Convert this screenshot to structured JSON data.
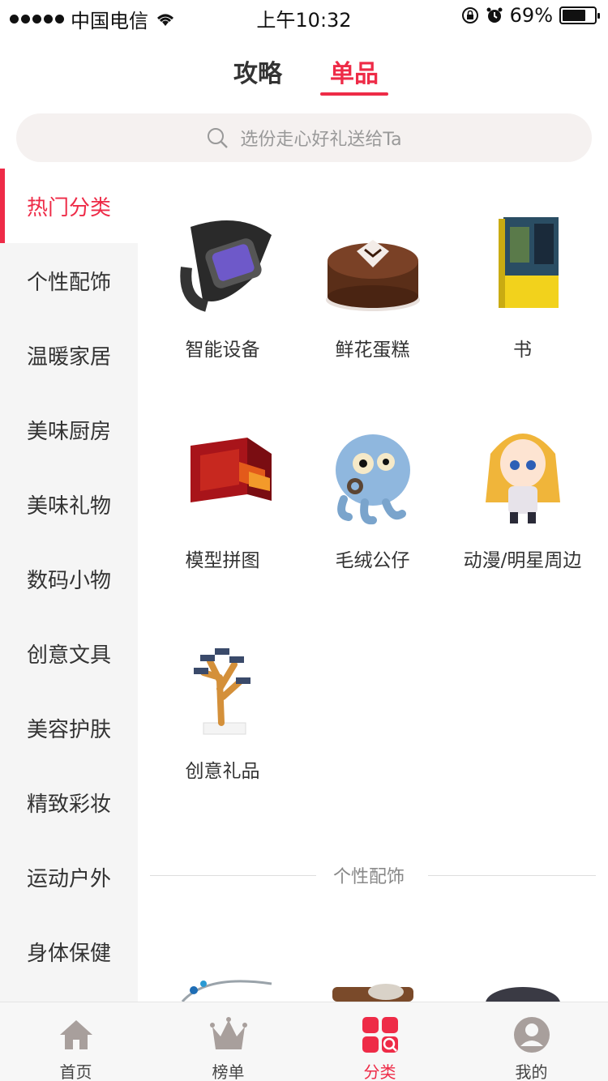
{
  "statusbar": {
    "carrier": "中国电信",
    "time": "上午10:32",
    "battery": "69%"
  },
  "top_tabs": [
    {
      "label": "攻略",
      "active": false
    },
    {
      "label": "单品",
      "active": true
    }
  ],
  "search": {
    "placeholder": "选份走心好礼送给Ta"
  },
  "sidebar": {
    "items": [
      {
        "label": "热门分类",
        "active": true
      },
      {
        "label": "个性配饰"
      },
      {
        "label": "温暖家居"
      },
      {
        "label": "美味厨房"
      },
      {
        "label": "美味礼物"
      },
      {
        "label": "数码小物"
      },
      {
        "label": "创意文具"
      },
      {
        "label": "美容护肤"
      },
      {
        "label": "精致彩妆"
      },
      {
        "label": "运动户外"
      },
      {
        "label": "身体保健"
      }
    ]
  },
  "grid": {
    "items": [
      {
        "label": "智能设备",
        "icon": "smart-band-image"
      },
      {
        "label": "鲜花蛋糕",
        "icon": "chocolate-cake-image"
      },
      {
        "label": "书",
        "icon": "book-image"
      },
      {
        "label": "模型拼图",
        "icon": "red-drawer-model-image"
      },
      {
        "label": "毛绒公仔",
        "icon": "octopus-plush-image"
      },
      {
        "label": "动漫/明星周边",
        "icon": "anime-figure-image"
      },
      {
        "label": "创意礼品",
        "icon": "solar-tree-image"
      }
    ]
  },
  "section": {
    "title": "个性配饰"
  },
  "tabbar": {
    "items": [
      {
        "label": "首页",
        "icon": "home-icon"
      },
      {
        "label": "榜单",
        "icon": "crown-icon"
      },
      {
        "label": "分类",
        "icon": "category-icon",
        "active": true
      },
      {
        "label": "我的",
        "icon": "user-icon"
      }
    ]
  },
  "colors": {
    "accent": "#ee2b47",
    "icon_gray": "#a89f9c",
    "sidebar_bg": "#f5f5f5"
  }
}
